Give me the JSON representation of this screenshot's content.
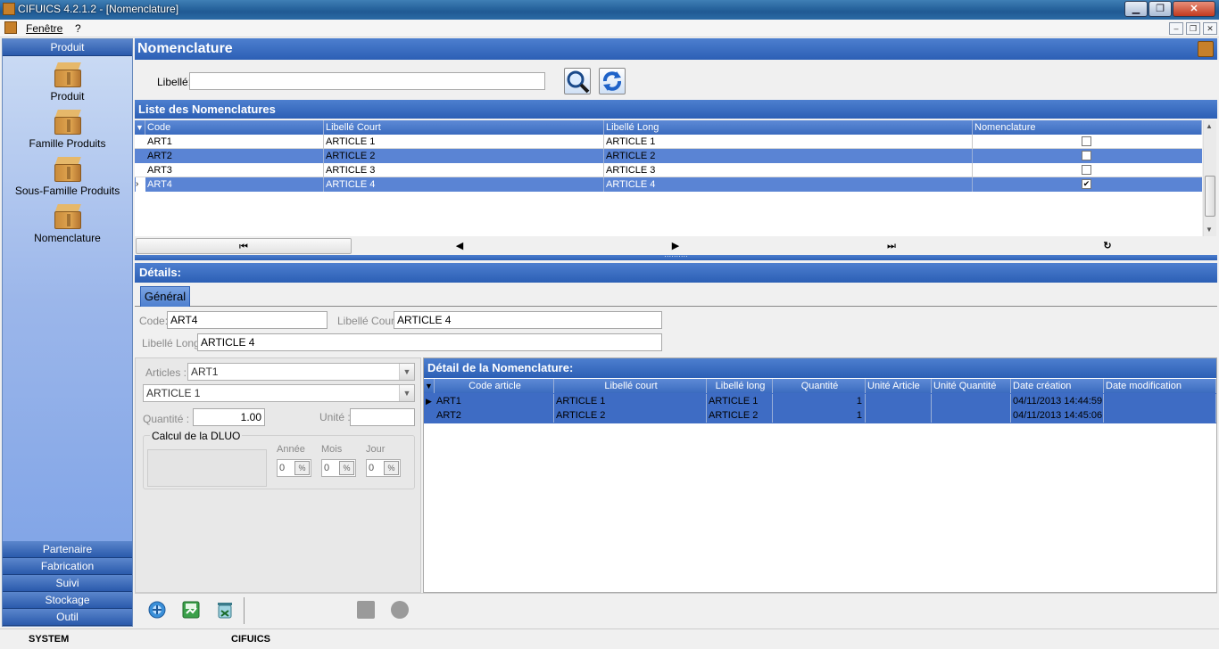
{
  "window": {
    "title": "CIFUICS 4.2.1.2 - [Nomenclature]",
    "min": "▁",
    "max": "❐",
    "close": "✕"
  },
  "menu": {
    "fenetre": "Fenêtre",
    "help": "?",
    "mdi_min": "–",
    "mdi_restore": "❐",
    "mdi_close": "✕"
  },
  "sidebar": {
    "top_header": "Produit",
    "items": [
      {
        "label": "Produit",
        "icon": "box-icon"
      },
      {
        "label": "Famille Produits",
        "icon": "box-icon"
      },
      {
        "label": "Sous-Famille Produits",
        "icon": "box-icon"
      },
      {
        "label": "Nomenclature",
        "icon": "box-icon"
      }
    ],
    "sections": [
      "Partenaire",
      "Fabrication",
      "Suivi",
      "Stockage",
      "Outil"
    ]
  },
  "header": {
    "title": "Nomenclature"
  },
  "search": {
    "label": "Libellé:",
    "value": ""
  },
  "list": {
    "title": "Liste des Nomenclatures",
    "columns": [
      "Code",
      "Libellé Court",
      "Libellé Long",
      "Nomenclature"
    ],
    "rows": [
      {
        "code": "ART1",
        "court": "ARTICLE 1",
        "long": "ARTICLE 1",
        "nomenclature": false
      },
      {
        "code": "ART2",
        "court": "ARTICLE 2",
        "long": "ARTICLE 2",
        "nomenclature": false
      },
      {
        "code": "ART3",
        "court": "ARTICLE 3",
        "long": "ARTICLE 3",
        "nomenclature": false
      },
      {
        "code": "ART4",
        "court": "ARTICLE 4",
        "long": "ARTICLE 4",
        "nomenclature": true
      }
    ],
    "selected_row": 3,
    "nav": {
      "first": "⏮",
      "prev": "◀",
      "next": "▶",
      "last": "⏭",
      "refresh": "↻"
    },
    "splitter": "··········"
  },
  "details": {
    "title": "Détails:",
    "tab": "Général",
    "code_label": "Code:",
    "code_value": "ART4",
    "court_label": "Libellé Court:",
    "court_value": "ARTICLE 4",
    "long_label": "Libellé Long:",
    "long_value": "ARTICLE 4"
  },
  "form": {
    "articles_label": "Articles :",
    "article_code": "ART1",
    "article_name": "ARTICLE 1",
    "quantite_label": "Quantité :",
    "quantite_value": "1.00",
    "unite_label": "Unité :",
    "unite_value": "",
    "dluo_title": "Calcul de la DLUO",
    "annee_label": "Année",
    "mois_label": "Mois",
    "jour_label": "Jour",
    "annee_value": "0",
    "mois_value": "0",
    "jour_value": "0"
  },
  "detail_grid": {
    "title": "Détail de la Nomenclature:",
    "columns": [
      "Code article",
      "Libellé court",
      "Libellé long",
      "Quantité",
      "Unité Article",
      "Unité Quantité",
      "Date création",
      "Date modification"
    ],
    "rows": [
      {
        "code": "ART1",
        "court": "ARTICLE 1",
        "long": "ARTICLE 1",
        "qte": "1",
        "unite_art": "",
        "unite_qte": "",
        "creation": "04/11/2013 14:44:59",
        "modif": ""
      },
      {
        "code": "ART2",
        "court": "ARTICLE 2",
        "long": "ARTICLE 2",
        "qte": "1",
        "unite_art": "",
        "unite_qte": "",
        "creation": "04/11/2013 14:45:06",
        "modif": ""
      }
    ]
  },
  "toolbar": {
    "add": "add-icon",
    "save": "save-icon",
    "delete": "delete-icon"
  },
  "status": {
    "left": "SYSTEM",
    "right": "CIFUICS"
  }
}
